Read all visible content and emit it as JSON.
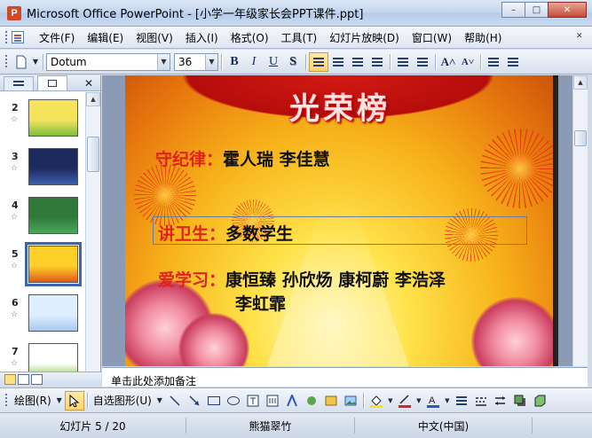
{
  "window": {
    "title": "Microsoft Office PowerPoint - [小学一年级家长会PPT课件.ppt]",
    "minimize": "–",
    "restore": "□",
    "close": "✕"
  },
  "menu": {
    "items": [
      "文件(F)",
      "编辑(E)",
      "视图(V)",
      "插入(I)",
      "格式(O)",
      "工具(T)",
      "幻灯片放映(D)",
      "窗口(W)",
      "帮助(H)"
    ]
  },
  "toolbar": {
    "font_name": "Dotum",
    "font_size": "36",
    "bold": "B",
    "italic": "I",
    "underline": "U",
    "shadow": "S",
    "grow_font": "A˄",
    "shrink_font": "A˅"
  },
  "slide_pane": {
    "tabs": [
      "outline-tab",
      "slides-tab"
    ],
    "close": "✕",
    "thumbnails": [
      {
        "number": "2",
        "colors": [
          "#f5e35c",
          "#7fbf3f"
        ]
      },
      {
        "number": "3",
        "colors": [
          "#1c2b5c",
          "#3b5fb0"
        ]
      },
      {
        "number": "4",
        "colors": [
          "#2f7a3a",
          "#4aa85a"
        ]
      },
      {
        "number": "5",
        "colors": [
          "#ffcf2a",
          "#e25a1a"
        ]
      },
      {
        "number": "6",
        "colors": [
          "#dfefff",
          "#a9c9ef"
        ]
      },
      {
        "number": "7",
        "colors": [
          "#ffffff",
          "#7fbf3f"
        ]
      }
    ],
    "selected_index": 3
  },
  "slide": {
    "title": "光荣榜",
    "row1_label": "守纪律：",
    "row1_names": "霍人瑞  李佳慧",
    "row2_label": "讲卫生：",
    "row2_names": "多数学生",
    "row3_label": "爱学习：",
    "row3_names": "康恒臻   孙欣炀   康柯蔚     李浩泽",
    "row3_names_cont": "李虹霏"
  },
  "notes": {
    "placeholder": "单击此处添加备注"
  },
  "draw_toolbar": {
    "draw_label": "绘图(R)",
    "autoshapes_label": "自选图形(U)"
  },
  "status": {
    "slide_position": "幻灯片 5 / 20",
    "design": "熊猫翠竹",
    "language": "中文(中国)"
  },
  "colors": {
    "accent_red": "#e0221c",
    "selection_blue": "#3a66b0"
  }
}
